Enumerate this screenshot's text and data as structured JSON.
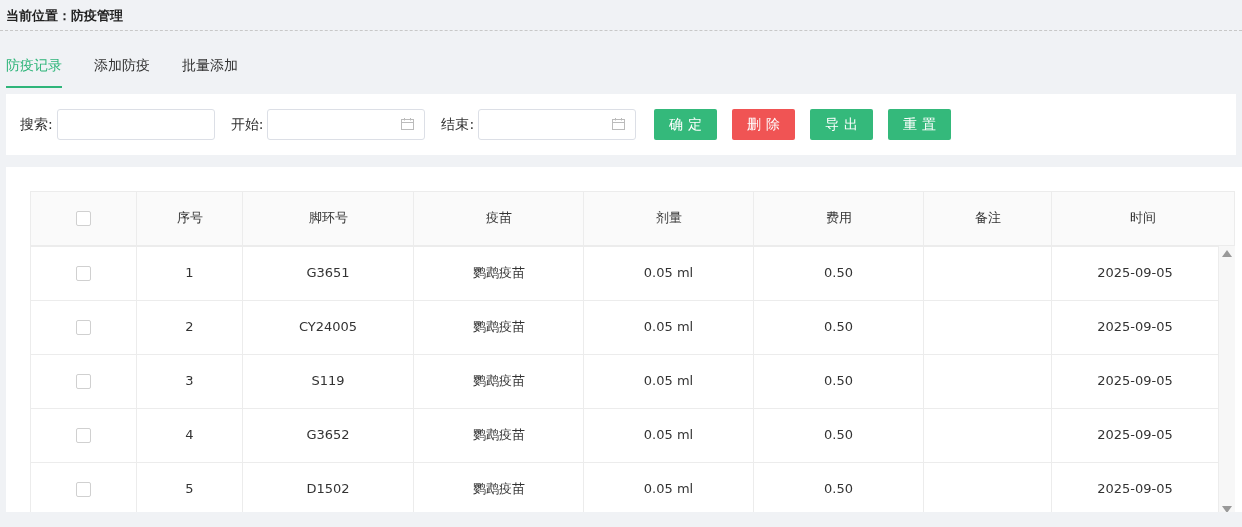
{
  "breadcrumb": {
    "label": "当前位置：",
    "value": "防疫管理"
  },
  "tabs": [
    {
      "label": "防疫记录",
      "selected": true
    },
    {
      "label": "添加防疫",
      "selected": false
    },
    {
      "label": "批量添加",
      "selected": false
    }
  ],
  "filters": [
    {
      "kind": "text",
      "label": "搜索:"
    },
    {
      "kind": "date",
      "label": "开始:"
    },
    {
      "kind": "date",
      "label": "结束:"
    }
  ],
  "buttons": [
    {
      "label": "确 定",
      "kind": "primary"
    },
    {
      "label": "删 除",
      "kind": "danger"
    },
    {
      "label": "导 出",
      "kind": "primary"
    },
    {
      "label": "重 置",
      "kind": "primary"
    }
  ],
  "table": {
    "select_all": {
      "checked": false
    },
    "columns": [
      "序号",
      "脚环号",
      "疫苗",
      "剂量",
      "费用",
      "备注",
      "时间"
    ],
    "rows": [
      {
        "checked": false,
        "cells": [
          "1",
          "G3651",
          "鹦鹉疫苗",
          "0.05 ml",
          "0.50",
          "",
          "2025-09-05"
        ]
      },
      {
        "checked": false,
        "cells": [
          "2",
          "CY24005",
          "鹦鹉疫苗",
          "0.05 ml",
          "0.50",
          "",
          "2025-09-05"
        ]
      },
      {
        "checked": false,
        "cells": [
          "3",
          "S119",
          "鹦鹉疫苗",
          "0.05 ml",
          "0.50",
          "",
          "2025-09-05"
        ]
      },
      {
        "checked": false,
        "cells": [
          "4",
          "G3652",
          "鹦鹉疫苗",
          "0.05 ml",
          "0.50",
          "",
          "2025-09-05"
        ]
      },
      {
        "checked": false,
        "cells": [
          "5",
          "D1502",
          "鹦鹉疫苗",
          "0.05 ml",
          "0.50",
          "",
          "2025-09-05"
        ]
      }
    ]
  }
}
